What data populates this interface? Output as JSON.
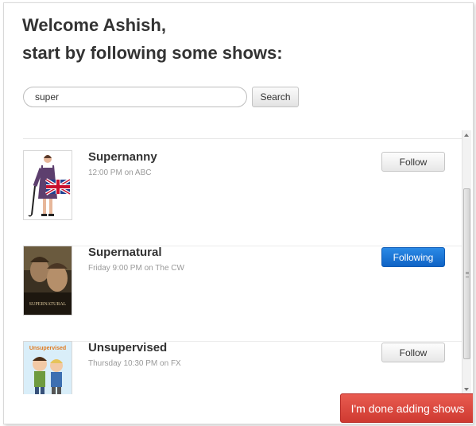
{
  "header": {
    "line1": "Welcome Ashish,",
    "line2": "start by following some shows:"
  },
  "search": {
    "value": "super",
    "button_label": "Search"
  },
  "shows": [
    {
      "name": "Supernanny",
      "time": "12:00 PM on ABC",
      "button_label": "Follow",
      "following": false,
      "thumbnail": "nanny-with-umbrella-and-union-jack"
    },
    {
      "name": "Supernatural",
      "time": "Friday 9:00 PM on The CW",
      "button_label": "Following",
      "following": true,
      "thumbnail": "supernatural-poster",
      "thumbnail_text": "SUPERNATURAL"
    },
    {
      "name": "Unsupervised",
      "time": "Thursday 10:30 PM on FX",
      "button_label": "Follow",
      "following": false,
      "thumbnail": "unsupervised-cartoon-poster",
      "thumbnail_text": "Unsupervised"
    }
  ],
  "footer": {
    "done_label": "I'm done adding shows"
  },
  "colors": {
    "following_button": "#1a73d4",
    "done_button": "#d9463d",
    "text_dark": "#333333",
    "text_muted": "#999999"
  }
}
